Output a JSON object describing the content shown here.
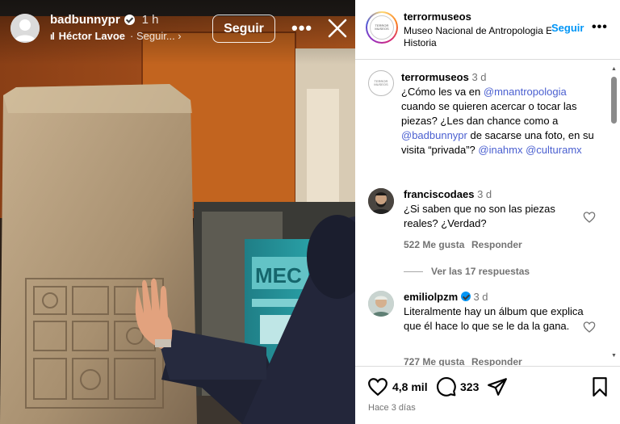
{
  "story": {
    "username": "badbunnypr",
    "time": "1 h",
    "music_icon": "music-bars-icon",
    "music_artist": "Héctor Lavoe",
    "music_more": "· Seguir... ›",
    "follow_label": "Seguir",
    "more_icon": "more-horizontal-icon",
    "close_icon": "close-icon"
  },
  "post": {
    "username": "terrormuseos",
    "location": "Museo Nacional de Antropologia E Historia",
    "follow_label": "Seguir",
    "avatar_logo_text": "TERROR MUSEOS",
    "caption": {
      "username": "terrormuseos",
      "time": "3 d",
      "text_1": "¿Cómo les va en ",
      "mention_1": "@mnantropologia",
      "text_2": " cuando se quieren acercar o tocar las piezas? ¿Les dan chance como a ",
      "mention_2": "@badbunnypr",
      "text_3": " de sacarse una foto, en su visita “privada”? ",
      "mention_3": "@inahmx",
      "text_4": " ",
      "mention_4": "@culturamx"
    },
    "comments": [
      {
        "username": "franciscodaes",
        "time": "3 d",
        "text": "¿Si saben que no son las piezas reales? ¿Verdad?",
        "likes": "522 Me gusta",
        "reply": "Responder",
        "view_replies": "Ver las 17 respuestas"
      },
      {
        "username": "emiliolpzm",
        "time": "3 d",
        "text": "Literalmente hay un álbum que explica que él hace lo que se le da la gana.",
        "likes": "727 Me gusta",
        "reply": "Responder"
      }
    ],
    "actions": {
      "likes_count": "4,8 mil",
      "comments_count": "323",
      "date": "Hace 3 días"
    }
  },
  "colors": {
    "link": "#0095f6",
    "mention": "#4a5fd0",
    "muted": "#737373"
  }
}
